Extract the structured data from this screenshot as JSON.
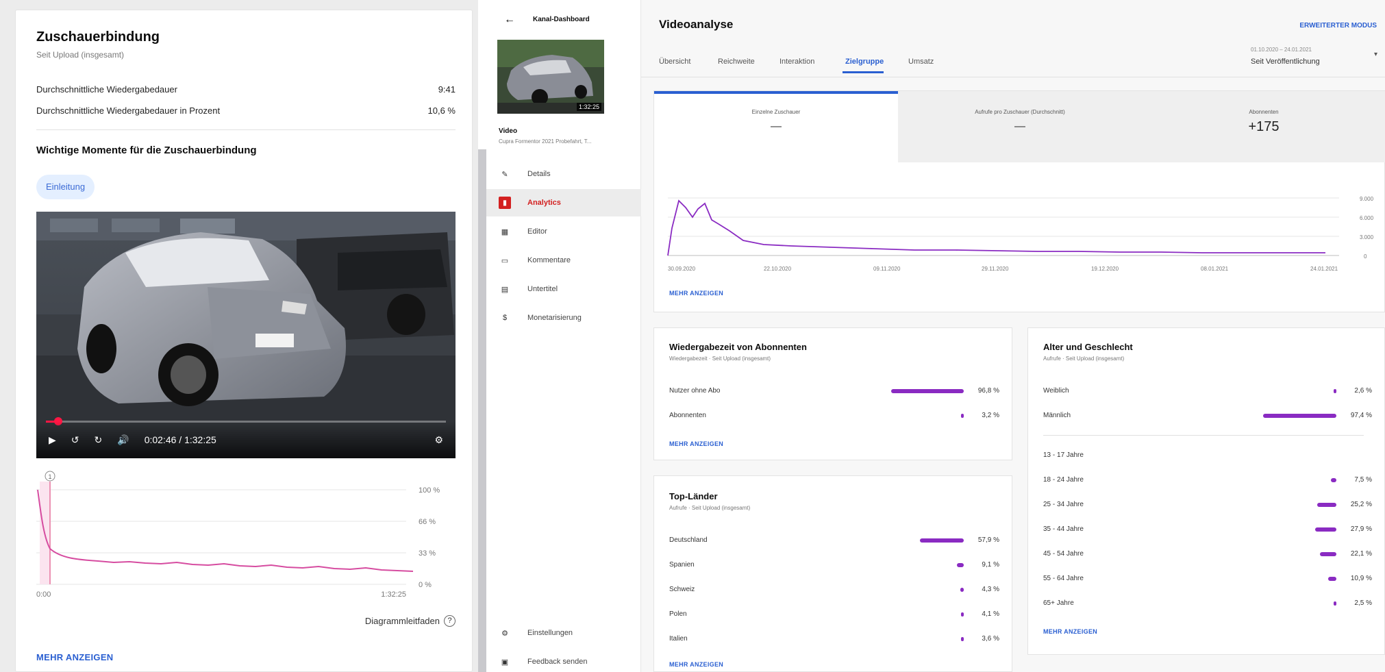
{
  "retention": {
    "title": "Zuschauerbindung",
    "subtitle": "Seit Upload (insgesamt)",
    "avg_duration_label": "Durchschnittliche Wiedergabedauer",
    "avg_duration_value": "9:41",
    "avg_pct_label": "Durchschnittliche Wiedergabedauer in Prozent",
    "avg_pct_value": "10,6 %",
    "moments_title": "Wichtige Momente für die Zuschauerbindung",
    "chip_label": "Einleitung",
    "player_time": "0:02:46 / 1:32:25",
    "progress": 0.03,
    "chart": {
      "y_ticks": [
        "100 %",
        "66 %",
        "33 %",
        "0 %"
      ],
      "x_start": "0:00",
      "x_end": "1:32:25",
      "marker": "1"
    },
    "guide_label": "Diagrammleitfaden",
    "show_more": "MEHR ANZEIGEN"
  },
  "sidebar": {
    "back_label": "Kanal-Dashboard",
    "thumb_duration": "1:32:25",
    "video_label": "Video",
    "video_title": "Cupra Formentor 2021 Probefahrt, T...",
    "items": [
      "Details",
      "Analytics",
      "Editor",
      "Kommentare",
      "Untertitel",
      "Monetarisierung"
    ],
    "bottom": [
      "Einstellungen",
      "Feedback senden"
    ]
  },
  "main": {
    "title": "Videoanalyse",
    "advanced": "ERWEITERTER MODUS",
    "tabs": [
      "Übersicht",
      "Reichweite",
      "Interaktion",
      "Zielgruppe",
      "Umsatz"
    ],
    "date_range": "01.10.2020 – 24.01.2021",
    "date_label": "Seit Veröffentlichung",
    "metrics": [
      {
        "label": "Einzelne Zuschauer",
        "value": "—"
      },
      {
        "label": "Aufrufe pro Zuschauer (Durchschnitt)",
        "value": "—"
      },
      {
        "label": "Abonnenten",
        "value": "+175"
      }
    ],
    "subs_chart": {
      "y_ticks": [
        "9.000",
        "6.000",
        "3.000",
        "0"
      ],
      "x_ticks": [
        "30.09.2020",
        "22.10.2020",
        "09.11.2020",
        "29.11.2020",
        "19.12.2020",
        "08.01.2021",
        "24.01.2021"
      ]
    },
    "show_more": "MEHR ANZEIGEN",
    "watch_time": {
      "title": "Wiedergabezeit von Abonnenten",
      "subtitle": "Wiedergabezeit · Seit Upload (insgesamt)",
      "rows": [
        {
          "label": "Nutzer ohne Abo",
          "pct": "96,8 %",
          "value": 96.8
        },
        {
          "label": "Abonnenten",
          "pct": "3,2 %",
          "value": 3.2
        }
      ],
      "show_more": "MEHR ANZEIGEN"
    },
    "countries": {
      "title": "Top-Länder",
      "subtitle": "Aufrufe · Seit Upload (insgesamt)",
      "rows": [
        {
          "label": "Deutschland",
          "pct": "57,9 %",
          "value": 57.9
        },
        {
          "label": "Spanien",
          "pct": "9,1 %",
          "value": 9.1
        },
        {
          "label": "Schweiz",
          "pct": "4,3 %",
          "value": 4.3
        },
        {
          "label": "Polen",
          "pct": "4,1 %",
          "value": 4.1
        },
        {
          "label": "Italien",
          "pct": "3,6 %",
          "value": 3.6
        }
      ],
      "show_more": "MEHR ANZEIGEN"
    },
    "age_gender": {
      "title": "Alter und Geschlecht",
      "subtitle": "Aufrufe · Seit Upload (insgesamt)",
      "gender": [
        {
          "label": "Weiblich",
          "pct": "2,6 %",
          "value": 2.6
        },
        {
          "label": "Männlich",
          "pct": "97,4 %",
          "value": 97.4
        }
      ],
      "ages": [
        {
          "label": "13 - 17 Jahre",
          "pct": "",
          "value": 0
        },
        {
          "label": "18 - 24 Jahre",
          "pct": "7,5 %",
          "value": 7.5
        },
        {
          "label": "25 - 34 Jahre",
          "pct": "25,2 %",
          "value": 25.2
        },
        {
          "label": "35 - 44 Jahre",
          "pct": "27,9 %",
          "value": 27.9
        },
        {
          "label": "45 - 54 Jahre",
          "pct": "22,1 %",
          "value": 22.1
        },
        {
          "label": "55 - 64 Jahre",
          "pct": "10,9 %",
          "value": 10.9
        },
        {
          "label": "65+ Jahre",
          "pct": "2,5 %",
          "value": 2.5
        }
      ],
      "show_more": "MEHR ANZEIGEN"
    }
  },
  "colors": {
    "accent": "#8a2bc2",
    "retention_line": "#d64ca0",
    "link": "#2a5fd1",
    "analytics_red": "#d32020"
  }
}
